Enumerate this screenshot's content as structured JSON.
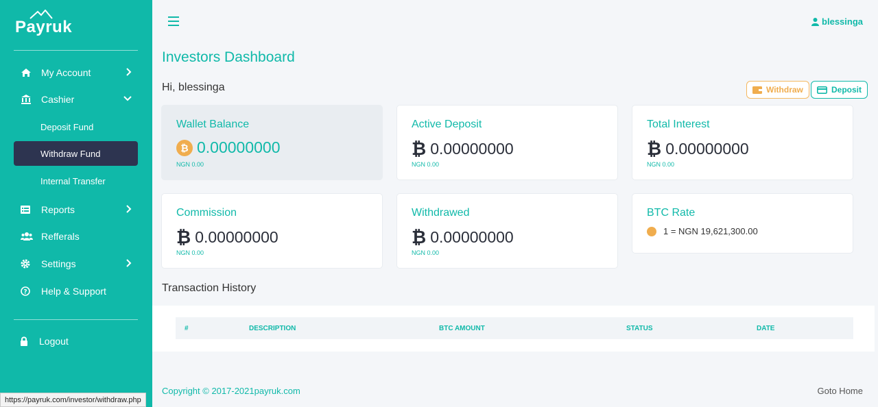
{
  "app": {
    "logo_text": "Payruk"
  },
  "sidebar": {
    "items": [
      {
        "label": "My Account",
        "icon": "home-icon"
      },
      {
        "label": "Cashier",
        "icon": "bank-icon"
      },
      {
        "label": "Deposit Fund"
      },
      {
        "label": "Withdraw Fund"
      },
      {
        "label": "Internal Transfer"
      },
      {
        "label": "Reports",
        "icon": "report-icon"
      },
      {
        "label": "Refferals",
        "icon": "users-icon"
      },
      {
        "label": "Settings",
        "icon": "gear-icon"
      },
      {
        "label": "Help & Support",
        "icon": "question-icon"
      }
    ],
    "logout_label": "Logout"
  },
  "header": {
    "username": "blessinga"
  },
  "main": {
    "title": "Investors Dashboard",
    "greeting": "Hi, blessinga",
    "withdraw_label": "Withdraw",
    "deposit_label": "Deposit"
  },
  "cards": [
    {
      "title": "Wallet Balance",
      "value": "0.00000000",
      "sub": "NGN 0.00"
    },
    {
      "title": "Active Deposit",
      "value": "0.00000000",
      "sub": "NGN 0.00"
    },
    {
      "title": "Total Interest",
      "value": "0.00000000",
      "sub": "NGN 0.00"
    },
    {
      "title": "Commission",
      "value": "0.00000000",
      "sub": "NGN 0.00"
    },
    {
      "title": "Withdrawed",
      "value": "0.00000000",
      "sub": "NGN 0.00"
    },
    {
      "title": "BTC Rate",
      "value": "1 = NGN 19,621,300.00"
    }
  ],
  "transactions": {
    "title": "Transaction History",
    "columns": [
      "#",
      "DESCRIPTION",
      "BTC AMOUNT",
      "STATUS",
      "DATE"
    ]
  },
  "footer": {
    "copyright": "Copyright © 2017-2021payruk.com",
    "home_link": "Goto Home"
  },
  "browser": {
    "status_url": "https://payruk.com/investor/withdraw.php"
  },
  "colors": {
    "brand": "#10b9a9",
    "active": "#2d3450",
    "accent": "#f0ad4e"
  }
}
